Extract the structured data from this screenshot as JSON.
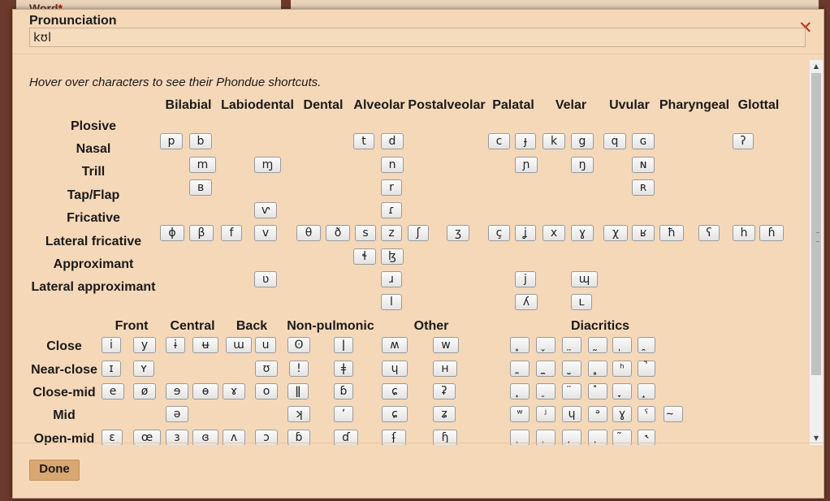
{
  "background": {
    "word_label": "Word",
    "required_mark": "*"
  },
  "dialog": {
    "title": "Pronunciation",
    "close_glyph": "✕",
    "pronunciation_value": "kʊl",
    "hint": "Hover over characters to see their Phondue shortcuts.",
    "done_label": "Done"
  },
  "consonants": {
    "columns": [
      "Bilabial",
      "Labiodental",
      "Dental",
      "Alveolar",
      "Postalveolar",
      "Palatal",
      "Velar",
      "Uvular",
      "Pharyngeal",
      "Glottal"
    ],
    "rows": [
      {
        "label": "Plosive",
        "keys": [
          "p",
          "b",
          "t",
          "d",
          "c",
          "ɟ",
          "k",
          "g",
          "q",
          "ɢ",
          "ʔ"
        ]
      },
      {
        "label": "Nasal",
        "keys": [
          "m",
          "ɱ",
          "n",
          "ɲ",
          "ŋ",
          "ɴ"
        ]
      },
      {
        "label": "Trill",
        "keys": [
          "ʙ",
          "r",
          "ʀ"
        ]
      },
      {
        "label": "Tap/Flap",
        "keys": [
          "ⱱ",
          "ɾ"
        ]
      },
      {
        "label": "Fricative",
        "keys": [
          "ɸ",
          "β",
          "f",
          "v",
          "θ",
          "ð",
          "s",
          "z",
          "ʃ",
          "ʒ",
          "ç",
          "ʝ",
          "x",
          "ɣ",
          "χ",
          "ʁ",
          "ħ",
          "ʕ",
          "h",
          "ɦ"
        ]
      },
      {
        "label": "Lateral fricative",
        "keys": [
          "ɬ",
          "ɮ"
        ]
      },
      {
        "label": "Approximant",
        "keys": [
          "ʋ",
          "ɹ",
          "j",
          "ɰ"
        ]
      },
      {
        "label": "Lateral approximant",
        "keys": [
          "l",
          "ʎ",
          "ʟ"
        ]
      }
    ]
  },
  "vowels": {
    "columns": [
      "Front",
      "Central",
      "Back",
      "Non-pulmonic",
      "Other",
      "Diacritics"
    ],
    "rows": [
      {
        "label": "Close",
        "keys": [
          "i",
          "y",
          "ɨ",
          "ʉ",
          "ɯ",
          "u",
          "ʘ",
          "ǀ",
          "ʍ",
          "w",
          "̥",
          "̬",
          "̤",
          "̰",
          "̩",
          "̯"
        ]
      },
      {
        "label": "Near-close",
        "keys": [
          "ɪ",
          "ʏ",
          "ʊ",
          "ǃ",
          "ǂ",
          "ɥ",
          "ʜ",
          "̪",
          "̼",
          "̺",
          "̻",
          "ʰ",
          "̚"
        ]
      },
      {
        "label": "Close-mid",
        "keys": [
          "e",
          "ø",
          "ɘ",
          "ɵ",
          "ɤ",
          "o",
          "ǁ",
          "ɓ",
          "ɕ",
          "ʡ",
          "̟",
          "̠",
          "̈",
          "̽",
          "̞",
          "̝"
        ]
      },
      {
        "label": "Mid",
        "keys": [
          "ə",
          "ʞ",
          "ʼ",
          "ɕ",
          "ʑ",
          "ʷ",
          "ʲ",
          "ɥ",
          "ᵊ",
          "ɣ",
          "ˤ",
          "̴"
        ]
      },
      {
        "label": "Open-mid",
        "keys": [
          "ɛ",
          "œ",
          "ɜ",
          "ɞ",
          "ʌ",
          "ɔ",
          "ɓ",
          "ɗ",
          "ʄ",
          "ɧ",
          "̹",
          "̜",
          "̘",
          "̙",
          "̃",
          "˞"
        ]
      }
    ]
  },
  "colors": {
    "dialog_bg": "#f4d8b8",
    "close": "#c0301c",
    "done_bg": "#d9a770"
  }
}
